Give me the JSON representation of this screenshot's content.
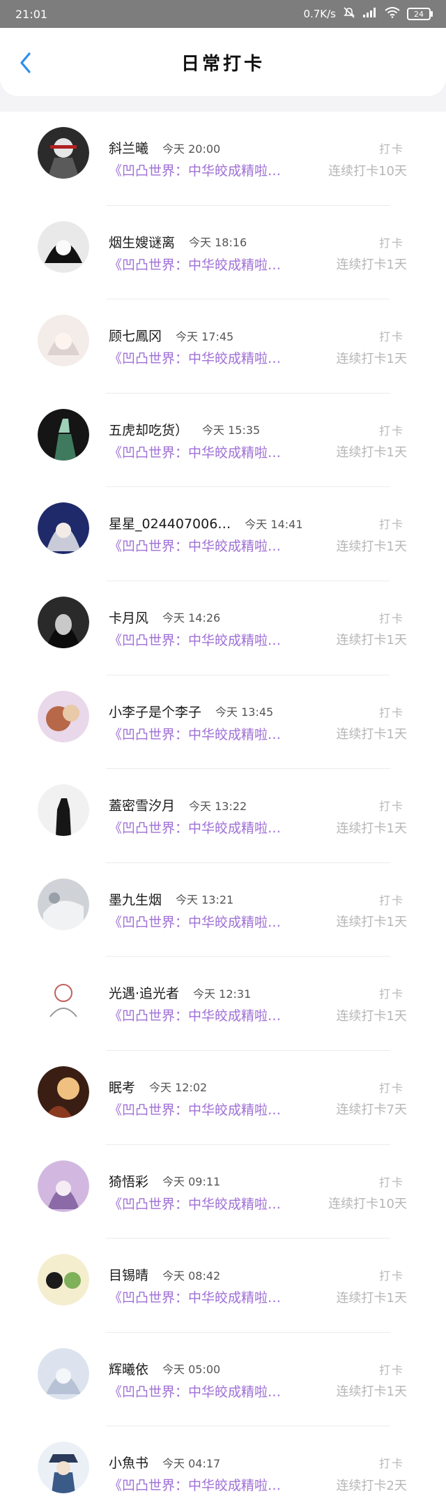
{
  "status": {
    "time": "21:01",
    "speed": "0.7K/s",
    "battery": "24"
  },
  "header": {
    "title": "日常打卡"
  },
  "common": {
    "action": "打卡",
    "topic": "《凹凸世界：中华皎成精啦…"
  },
  "colors": {
    "topic": "#9f6fd6",
    "streak": "#b6b6b6",
    "back": "#2d8df0"
  },
  "items": [
    {
      "name": "斜兰曦",
      "time": "今天 20:00",
      "streak": "连续打卡10天",
      "avatar": "dark-warrior"
    },
    {
      "name": "烟生嫂谜离",
      "time": "今天 18:16",
      "streak": "连续打卡1天",
      "avatar": "gothic-girl"
    },
    {
      "name": "顾七鳳冈",
      "time": "今天 17:45",
      "streak": "连续打卡1天",
      "avatar": "pale-girl"
    },
    {
      "name": "五虎却吃货）",
      "time": "今天 15:35",
      "streak": "连续打卡1天",
      "avatar": "green-spirit"
    },
    {
      "name": "星星_024407006…",
      "time": "今天 14:41",
      "streak": "连续打卡1天",
      "avatar": "silver-hair"
    },
    {
      "name": "卡月风",
      "time": "今天 14:26",
      "streak": "连续打卡1天",
      "avatar": "dark-portrait"
    },
    {
      "name": "小李子是个李子",
      "time": "今天 13:45",
      "streak": "连续打卡1天",
      "avatar": "warm-sketch"
    },
    {
      "name": "蓋密雪汐月",
      "time": "今天 13:22",
      "streak": "连续打卡1天",
      "avatar": "silhouette"
    },
    {
      "name": "墨九生烟",
      "time": "今天 13:21",
      "streak": "连续打卡1天",
      "avatar": "mist"
    },
    {
      "name": "光遇·追光者",
      "time": "今天 12:31",
      "streak": "连续打卡1天",
      "avatar": "sketch"
    },
    {
      "name": "眠考",
      "time": "今天 12:02",
      "streak": "连续打卡7天",
      "avatar": "firelight"
    },
    {
      "name": "猗悟彩",
      "time": "今天 09:11",
      "streak": "连续打卡10天",
      "avatar": "lavender"
    },
    {
      "name": "目锡晴",
      "time": "今天 08:42",
      "streak": "连续打卡1天",
      "avatar": "duo"
    },
    {
      "name": "辉曦依",
      "time": "今天 05:00",
      "streak": "连续打卡1天",
      "avatar": "frost"
    },
    {
      "name": "小魚书",
      "time": "今天 04:17",
      "streak": "连续打卡2天",
      "avatar": "hat-boy"
    }
  ]
}
